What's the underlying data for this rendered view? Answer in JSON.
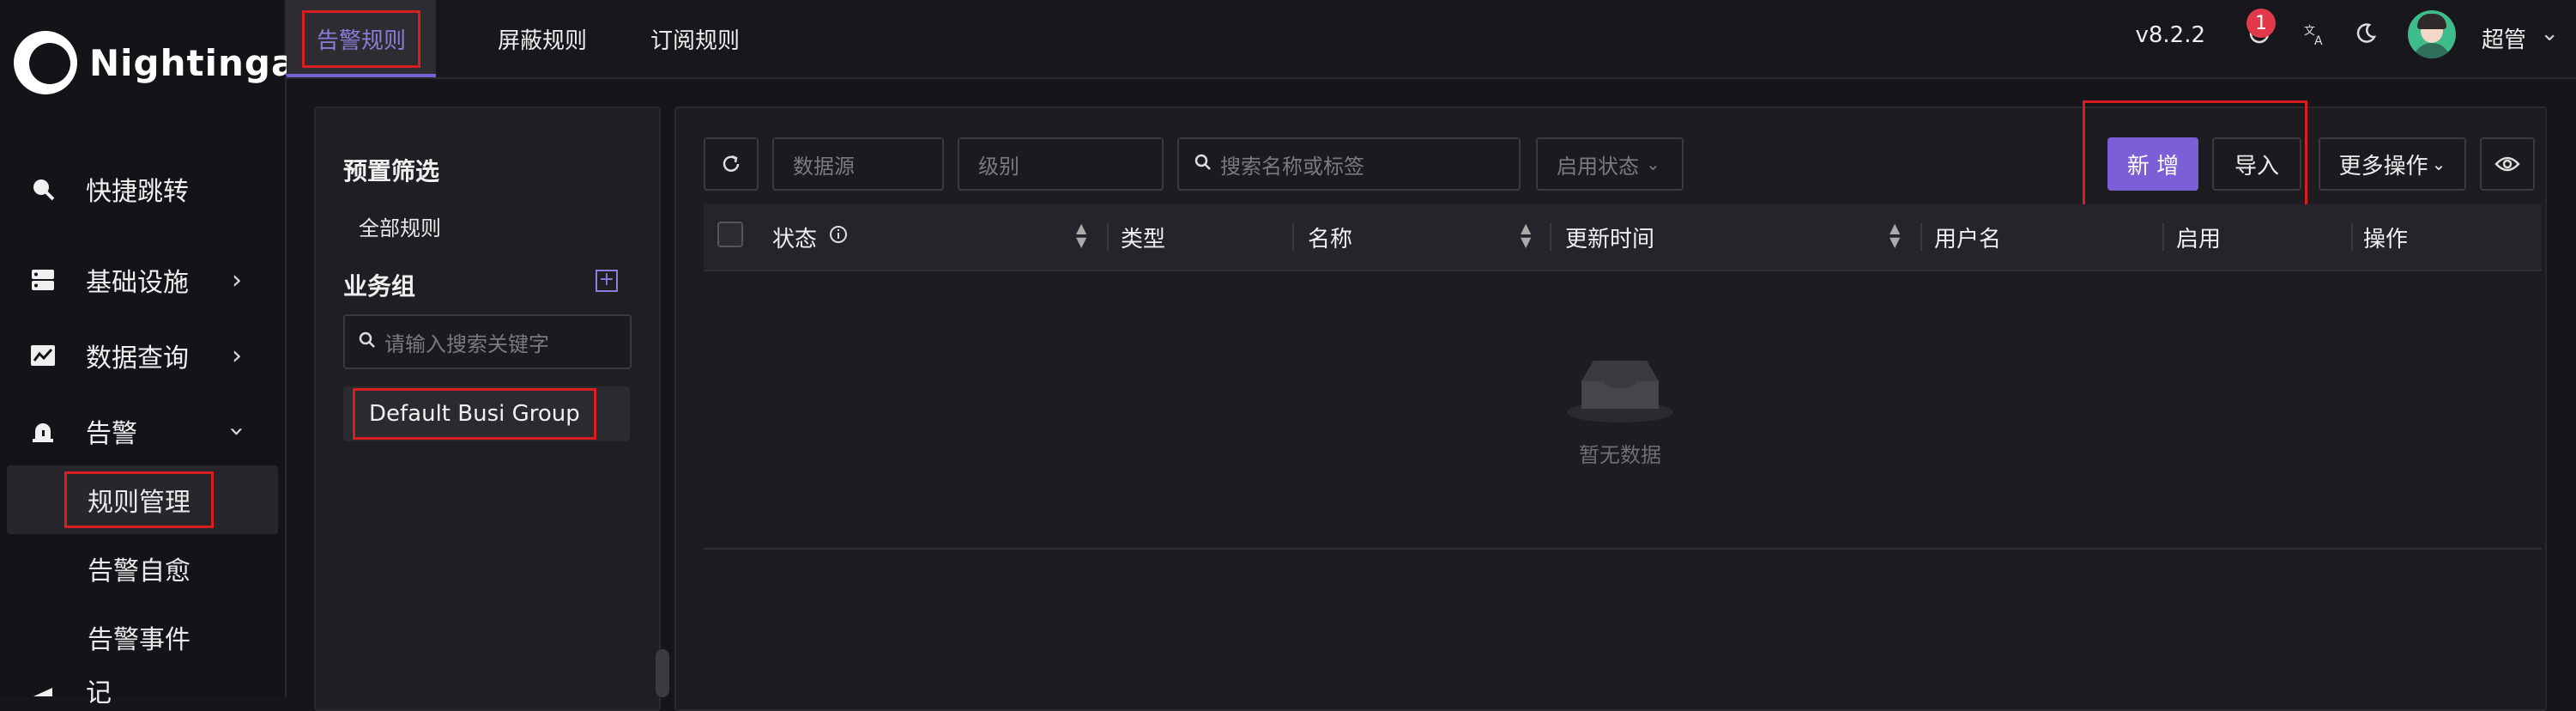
{
  "app": {
    "logo_text": "Nightingale"
  },
  "sidebar": {
    "items": [
      {
        "label": "快捷跳转",
        "icon": "search-icon"
      },
      {
        "label": "基础设施",
        "icon": "server-icon",
        "expandable": true
      },
      {
        "label": "数据查询",
        "icon": "chart-line-icon",
        "expandable": true
      },
      {
        "label": "告警",
        "icon": "alarm-bell-icon",
        "expanded": true
      }
    ],
    "sub_items": [
      {
        "label": "规则管理",
        "active": true
      },
      {
        "label": "告警自愈"
      },
      {
        "label": "告警事件"
      }
    ],
    "cut_item_label": "记"
  },
  "header": {
    "tabs": [
      {
        "label": "告警规则",
        "active": true
      },
      {
        "label": "屏蔽规则"
      },
      {
        "label": "订阅规则"
      }
    ],
    "version": "v8.2.2",
    "notification_count": "1",
    "user_name": "超管",
    "icons": [
      "clock-icon",
      "translate-icon",
      "moon-icon"
    ]
  },
  "filter_panel": {
    "preset_title": "预置筛选",
    "all_rules_link": "全部规则",
    "busi_group_title": "业务组",
    "search_placeholder": "请输入搜索关键字",
    "busi_groups": [
      "Default Busi Group"
    ]
  },
  "toolbar": {
    "datasource_placeholder": "数据源",
    "severity_placeholder": "级别",
    "search_placeholder": "搜索名称或标签",
    "status_select": "启用状态",
    "add_button": "新 增",
    "import_button": "导入",
    "more_actions": "更多操作"
  },
  "table": {
    "columns": [
      "状态",
      "类型",
      "名称",
      "更新时间",
      "用户名",
      "启用",
      "操作"
    ],
    "empty_text": "暂无数据"
  },
  "colors": {
    "accent": "#7b5fd6",
    "highlight_box": "#d81e1e",
    "badge": "#e23a4b"
  }
}
